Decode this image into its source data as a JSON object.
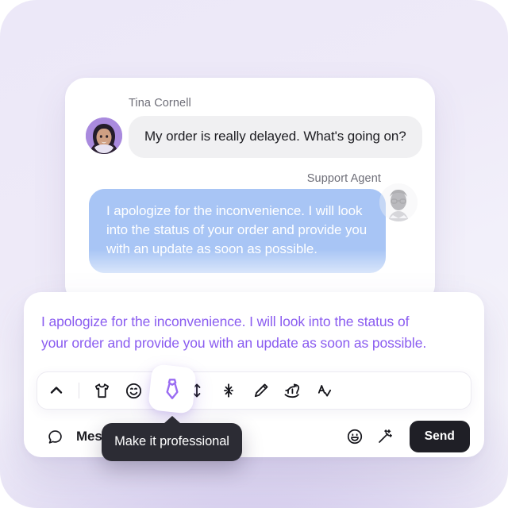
{
  "background": {
    "gradient_top": "#ece8f8",
    "gradient_bottom": "#cdc3ea"
  },
  "chat": {
    "messages": [
      {
        "sender": "Tina Cornell",
        "side": "incoming",
        "text": "My order is really delayed. What's going on?",
        "bubble_color": "#f0f0f2",
        "avatar": "customer-photo-avatar"
      },
      {
        "sender": "Support Agent",
        "side": "outgoing",
        "lines": [
          "I apologize for the inconvenience. I will look",
          "into the status of your order and provide you",
          "with an update as soon as possible."
        ],
        "bubble_color": "#a8c5f5",
        "avatar": "agent-photo-avatar"
      }
    ]
  },
  "composer": {
    "suggestion": {
      "accent_color": "#8a5cf0",
      "lines": [
        "I apologize for the inconvenience. I will look into the status of",
        "your order and provide you with an update as soon as possible."
      ]
    },
    "tone_toolbar": {
      "collapse_icon": "chevron-up-icon",
      "items": [
        {
          "name": "tshirt-icon",
          "label": "Make it casual",
          "active": false
        },
        {
          "name": "smiley-icon",
          "label": "Make it friendly",
          "active": false
        },
        {
          "name": "necktie-icon",
          "label": "Make it professional",
          "active": true
        },
        {
          "name": "expand-icon",
          "label": "Make it longer",
          "active": false
        },
        {
          "name": "shorten-icon",
          "label": "Make it shorter",
          "active": false
        },
        {
          "name": "pencil-icon",
          "label": "Rewrite",
          "active": false
        },
        {
          "name": "rocking-horse-icon",
          "label": "Simplify",
          "active": false
        },
        {
          "name": "spellcheck-icon",
          "label": "Fix spelling & grammar",
          "active": false
        }
      ]
    },
    "input_row": {
      "message_icon": "chat-bubble-icon",
      "placeholder": "Message",
      "emoji_icon": "emoji-smiley-icon",
      "ai_icon": "magic-wand-icon",
      "send_label": "Send",
      "send_color": "#1f1f26"
    }
  },
  "tooltip": {
    "text": "Make it professional",
    "background": "#2c2c34"
  }
}
